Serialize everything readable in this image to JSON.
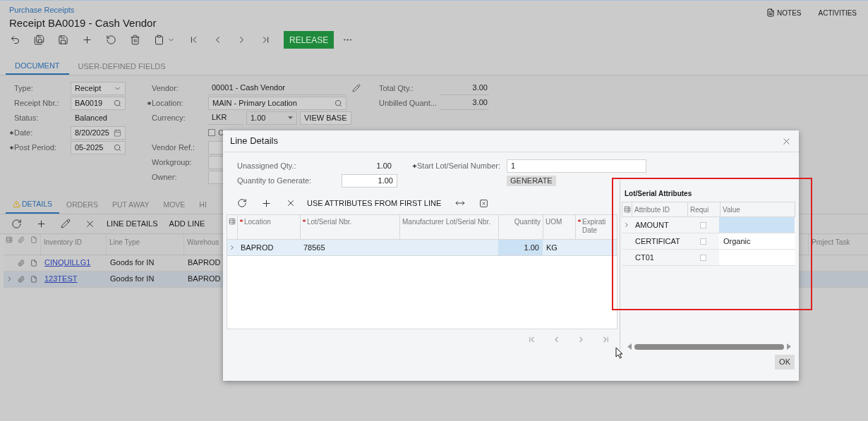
{
  "breadcrumb": "Purchase Receipts",
  "title": "Receipt BA0019 - Cash Vendor",
  "header_links": [
    {
      "label": "NOTES",
      "kind": "notes"
    },
    {
      "label": "ACTIVITIES",
      "kind": "plain"
    }
  ],
  "release_button": "RELEASE",
  "form_tabs": [
    {
      "label": "DOCUMENT",
      "selected": true
    },
    {
      "label": "USER-DEFINED FIELDS",
      "selected": false
    }
  ],
  "form_columns": [
    [
      {
        "label": "Type:",
        "value": "Receipt",
        "kind": "select",
        "required": false
      },
      {
        "label": "Receipt Nbr.:",
        "value": "BA0019",
        "kind": "search",
        "required": false
      },
      {
        "label": "Status:",
        "value": "Balanced",
        "kind": "plain",
        "required": false
      },
      {
        "label": "Date:",
        "value": "8/20/2025",
        "kind": "date",
        "required": true
      },
      {
        "label": "Post Period:",
        "value": "05-2025",
        "kind": "search",
        "required": true
      }
    ],
    [
      {
        "label": "Vendor:",
        "value": "00001 - Cash Vendor",
        "kind": "edit",
        "required": false
      },
      {
        "label": "Location:",
        "value": "MAIN - Primary Location",
        "kind": "search",
        "required": true
      },
      {
        "label": "Currency:",
        "value": "LKR",
        "rate": "1.00",
        "button": "VIEW BASE",
        "kind": "currency",
        "required": false
      },
      {
        "label": "C",
        "kind": "checkbox",
        "checked": false,
        "required": false
      },
      {
        "label": "Vendor Ref.:",
        "kind": "empty",
        "required": false
      },
      {
        "label": "Workgroup:",
        "kind": "empty",
        "required": false
      },
      {
        "label": "Owner:",
        "kind": "empty",
        "required": false
      }
    ],
    [
      {
        "label": "Total Qty.:",
        "value": "3.00",
        "kind": "number",
        "required": false
      },
      {
        "label": "Unbilled Quant...",
        "value": "3.00",
        "kind": "number",
        "required": false
      }
    ]
  ],
  "detail_tabs": [
    {
      "label": "DETAILS",
      "selected": true,
      "warning": true
    },
    {
      "label": "ORDERS",
      "selected": false,
      "warning": false
    },
    {
      "label": "PUT AWAY",
      "selected": false,
      "warning": false
    },
    {
      "label": "MOVE",
      "selected": false,
      "warning": false
    },
    {
      "label": "HI",
      "selected": false,
      "warning": false
    }
  ],
  "detail_toolbar": [
    "LINE DETAILS",
    "ADD LINE"
  ],
  "table": {
    "columns": [
      "Inventory ID",
      "Line Type",
      "Warehous",
      "Project Task"
    ],
    "rows": [
      {
        "inventory_id": "CINQUILLG1",
        "line_type": "Goods for IN",
        "warehouse": "BAPROD",
        "selected": false
      },
      {
        "inventory_id": "123TEST",
        "line_type": "Goods for IN",
        "warehouse": "BAPROD",
        "selected": true
      }
    ]
  },
  "dialog": {
    "title": "Line Details",
    "unassigned_qty": {
      "label": "Unassigned Qty.:",
      "value": "1.00"
    },
    "quantity_to_generate": {
      "label": "Quantity to Generate:",
      "value": "1.00"
    },
    "start_lot_serial": {
      "label": "Start Lot/Serial Number:",
      "value": "1",
      "required": true
    },
    "generate_button": "GENERATE",
    "toolbar_button": "USE ATTRIBUTES FROM FIRST LINE",
    "grid": {
      "columns": [
        {
          "label": "Location",
          "required": true
        },
        {
          "label": "Lot/Serial Nbr.",
          "required": true
        },
        {
          "label": "Manufacturer Lot/Serial Nbr.",
          "required": false
        },
        {
          "label": "Quantity",
          "required": false
        },
        {
          "label": "UOM",
          "required": false
        },
        {
          "label": "Expirati Date",
          "required": true
        }
      ],
      "rows": [
        {
          "selected": true,
          "cells": [
            {
              "text": "BAPROD",
              "active": false
            },
            {
              "text": "78565",
              "active": false
            },
            {
              "active": false
            },
            {
              "text": "1.00",
              "active": true
            },
            {
              "text": "KG",
              "active": false
            },
            {
              "active": false
            }
          ]
        }
      ]
    },
    "attributes": {
      "title": "Lot/Serial Attributes",
      "columns": [
        "Attribute ID",
        "Requi",
        "Value"
      ],
      "rows": [
        {
          "attribute_id": "AMOUNT",
          "required_checked": false,
          "selected": true
        },
        {
          "attribute_id": "CERTIFICAT",
          "required_checked": false,
          "value": "Organic",
          "selected": false
        },
        {
          "attribute_id": "CT01",
          "required_checked": false,
          "selected": false
        }
      ]
    },
    "ok_button": "OK"
  }
}
